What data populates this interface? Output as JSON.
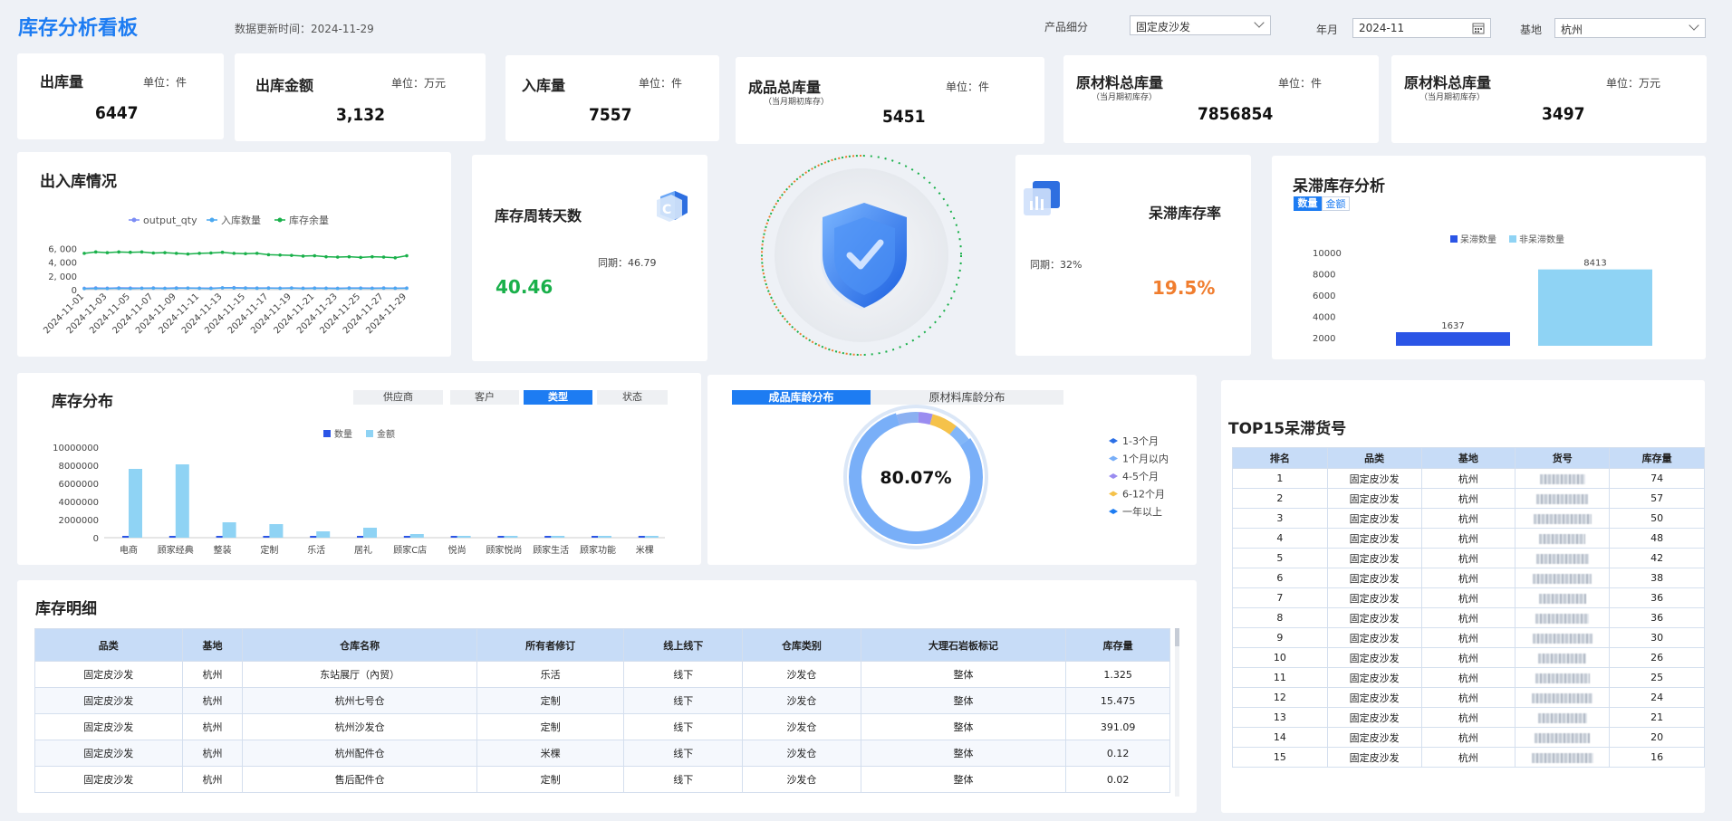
{
  "header": {
    "title": "库存分析看板",
    "update_label": "数据更新时间：2024-11-29",
    "filters": {
      "product_label": "产品细分",
      "product_value": "固定皮沙发",
      "month_label": "年月",
      "month_value": "2024-11",
      "base_label": "基地",
      "base_value": "杭州"
    }
  },
  "kpis": [
    {
      "title": "出库量",
      "sub": "",
      "unit": "单位：件",
      "value": "6447"
    },
    {
      "title": "出库金额",
      "sub": "",
      "unit": "单位：万元",
      "value": "3,132"
    },
    {
      "title": "入库量",
      "sub": "",
      "unit": "单位：件",
      "value": "7557"
    },
    {
      "title": "成品总库量",
      "sub": "（当月期初库存）",
      "unit": "单位：件",
      "value": "5451"
    },
    {
      "title": "原材料总库量",
      "sub": "（当月期初库存）",
      "unit": "单位：件",
      "value": "7856854"
    },
    {
      "title": "原材料总库量",
      "sub": "（当月期初库存）",
      "unit": "单位：万元",
      "value": "3497"
    }
  ],
  "inout": {
    "title": "出入库情况"
  },
  "turnover": {
    "title": "库存周转天数",
    "value": "40.46",
    "yoy": "同期：46.79"
  },
  "stagnant_rate": {
    "title": "呆滞库存率",
    "value": "19.5%",
    "yoy": "同期：32%"
  },
  "stagnant": {
    "title": "呆滞库存分析",
    "tab_count": "数量",
    "tab_amount": "金额"
  },
  "dist": {
    "title": "库存分布",
    "tabs": [
      "供应商",
      "客户",
      "类型",
      "状态"
    ],
    "active_tab": "类型"
  },
  "age": {
    "tabs": [
      "成品库龄分布",
      "原材料库龄分布"
    ],
    "center_label": "80.07%"
  },
  "detail": {
    "title": "库存明细",
    "columns": [
      "品类",
      "基地",
      "仓库名称",
      "所有者修订",
      "线上线下",
      "仓库类别",
      "大理石岩板标记",
      "库存量"
    ],
    "rows": [
      [
        "固定皮沙发",
        "杭州",
        "东站展厅（內贸）",
        "乐活",
        "线下",
        "沙发仓",
        "整体",
        "1.325"
      ],
      [
        "固定皮沙发",
        "杭州",
        "杭州七号仓",
        "定制",
        "线下",
        "沙发仓",
        "整体",
        "15.475"
      ],
      [
        "固定皮沙发",
        "杭州",
        "杭州沙发仓",
        "定制",
        "线下",
        "沙发仓",
        "整体",
        "391.09"
      ],
      [
        "固定皮沙发",
        "杭州",
        "杭州配件仓",
        "米棵",
        "线下",
        "沙发仓",
        "整体",
        "0.12"
      ],
      [
        "固定皮沙发",
        "杭州",
        "售后配件仓",
        "定制",
        "线下",
        "沙发仓",
        "整体",
        "0.02"
      ]
    ]
  },
  "top15": {
    "title": "TOP15呆滞货号",
    "columns": [
      "排名",
      "品类",
      "基地",
      "货号",
      "库存量"
    ],
    "rows": [
      [
        "1",
        "固定皮沙发",
        "杭州",
        "74"
      ],
      [
        "2",
        "固定皮沙发",
        "杭州",
        "57"
      ],
      [
        "3",
        "固定皮沙发",
        "杭州",
        "50"
      ],
      [
        "4",
        "固定皮沙发",
        "杭州",
        "48"
      ],
      [
        "5",
        "固定皮沙发",
        "杭州",
        "42"
      ],
      [
        "6",
        "固定皮沙发",
        "杭州",
        "38"
      ],
      [
        "7",
        "固定皮沙发",
        "杭州",
        "36"
      ],
      [
        "8",
        "固定皮沙发",
        "杭州",
        "36"
      ],
      [
        "9",
        "固定皮沙发",
        "杭州",
        "30"
      ],
      [
        "10",
        "固定皮沙发",
        "杭州",
        "26"
      ],
      [
        "11",
        "固定皮沙发",
        "杭州",
        "25"
      ],
      [
        "12",
        "固定皮沙发",
        "杭州",
        "24"
      ],
      [
        "13",
        "固定皮沙发",
        "杭州",
        "21"
      ],
      [
        "14",
        "固定皮沙发",
        "杭州",
        "20"
      ],
      [
        "15",
        "固定皮沙发",
        "杭州",
        "16"
      ]
    ]
  },
  "colors": {
    "primary": "#1d7cf2",
    "green": "#19b04a",
    "orange": "#f07d2e",
    "navy_bar": "#2b55e6",
    "light_bar": "#8fd3f4"
  },
  "chart_data": [
    {
      "type": "line",
      "x": [
        "2024-11-01",
        "2024-11-02",
        "2024-11-03",
        "2024-11-04",
        "2024-11-05",
        "2024-11-06",
        "2024-11-07",
        "2024-11-08",
        "2024-11-09",
        "2024-11-10",
        "2024-11-11",
        "2024-11-12",
        "2024-11-13",
        "2024-11-14",
        "2024-11-15",
        "2024-11-16",
        "2024-11-17",
        "2024-11-18",
        "2024-11-19",
        "2024-11-20",
        "2024-11-21",
        "2024-11-22",
        "2024-11-23",
        "2024-11-24",
        "2024-11-25",
        "2024-11-26",
        "2024-11-27",
        "2024-11-28",
        "2024-11-29"
      ],
      "x_tick_labels": [
        "2024-11-01",
        "2024-11-03",
        "2024-11-05",
        "2024-11-07",
        "2024-11-09",
        "2024-11-11",
        "2024-11-13",
        "2024-11-15",
        "2024-11-17",
        "2024-11-19",
        "2024-11-21",
        "2024-11-23",
        "2024-11-25",
        "2024-11-27",
        "2024-11-29"
      ],
      "y_ticks": [
        "6, 000",
        "4, 000",
        "2, 000",
        "0"
      ],
      "ylim": [
        0,
        7000
      ],
      "series": [
        {
          "name": "output_qty",
          "color": "#7b8cf5",
          "values": [
            200,
            250,
            220,
            260,
            240,
            230,
            250,
            210,
            260,
            240,
            230,
            220,
            280,
            300,
            260,
            240,
            250,
            230,
            260,
            220,
            240,
            230,
            210,
            250,
            240,
            230,
            250,
            220,
            240
          ]
        },
        {
          "name": "入库数量",
          "color": "#4aa8f0",
          "values": [
            150,
            180,
            160,
            200,
            170,
            190,
            210,
            180,
            200,
            230,
            190,
            170,
            260,
            240,
            220,
            200,
            210,
            190,
            230,
            180,
            200,
            190,
            170,
            210,
            200,
            180,
            210,
            190,
            200
          ]
        },
        {
          "name": "库存余量",
          "color": "#19b04a",
          "values": [
            5300,
            5500,
            5400,
            5500,
            5450,
            5500,
            5350,
            5400,
            5300,
            5200,
            5300,
            5350,
            5450,
            5300,
            5250,
            5300,
            5100,
            5050,
            5000,
            4900,
            4950,
            4800,
            4750,
            4800,
            4700,
            4800,
            4750,
            4650,
            4950
          ]
        }
      ],
      "grid": false,
      "legend": "top"
    },
    {
      "type": "bar",
      "categories": [
        "呆滞数量",
        "非呆滞数量"
      ],
      "values": [
        1637,
        8413
      ],
      "data_labels": [
        "1637",
        "8413"
      ],
      "y_ticks": [
        "10000",
        "8000",
        "6000",
        "4000",
        "2000"
      ],
      "ylim": [
        2000,
        10000
      ],
      "legend": "top"
    },
    {
      "type": "bar",
      "categories": [
        "电商",
        "顾家经典",
        "整装",
        "定制",
        "乐活",
        "居礼",
        "顾家C店",
        "悦尚",
        "顾家悦尚",
        "顾家生活",
        "顾家功能",
        "米棵"
      ],
      "y_ticks": [
        "10000000",
        "8000000",
        "6000000",
        "4000000",
        "2000000",
        "0"
      ],
      "ylim": [
        0,
        10000000
      ],
      "series": [
        {
          "name": "数量",
          "color": "#2b55e6",
          "values": [
            160000,
            140000,
            110000,
            90000,
            70000,
            60000,
            40000,
            30000,
            25000,
            20000,
            20000,
            15000
          ]
        },
        {
          "name": "金额",
          "color": "#8fd3f4",
          "values": [
            7600000,
            8100000,
            1700000,
            1500000,
            700000,
            1100000,
            400000,
            150000,
            120000,
            100000,
            110000,
            90000
          ]
        }
      ],
      "legend": "top"
    },
    {
      "type": "pie",
      "categories": [
        "1-3个月",
        "1个月以内",
        "4-5个月",
        "6-12个月",
        "一年以上"
      ],
      "colors": [
        "#2b6fe6",
        "#79aff8",
        "#9a8cf0",
        "#f5c24a",
        "#1d7cf2"
      ],
      "values": [
        5.5,
        80.07,
        3.5,
        6.5,
        4.43
      ],
      "center_label": "80.07%",
      "legend": "right"
    }
  ]
}
